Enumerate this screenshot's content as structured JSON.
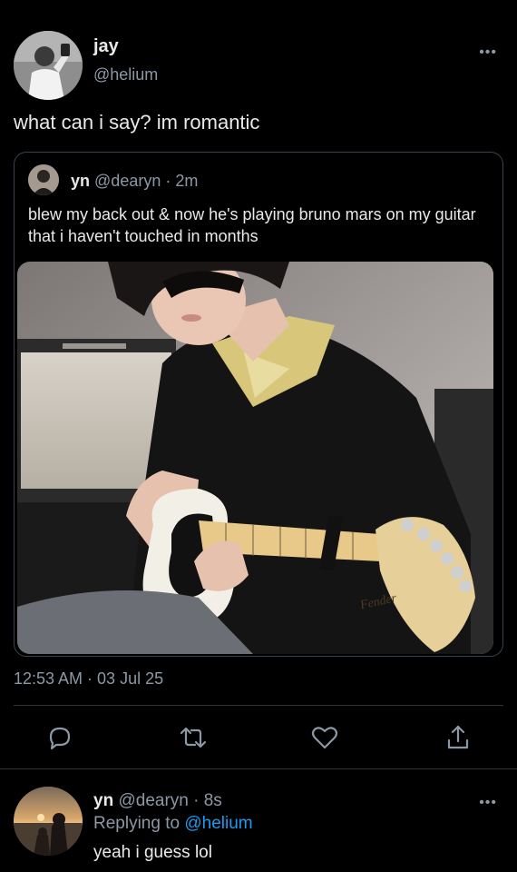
{
  "tweet": {
    "display_name": "jay",
    "handle": "@helium",
    "more_glyph": "•••",
    "text": "what can i say? im romantic",
    "timestamp": "12:53 AM · 03 Jul 25"
  },
  "quoted": {
    "display_name": "yn",
    "handle_time": "@dearyn · 2m",
    "text": "blew my back out & now he's playing bruno mars on my guitar that i haven't touched in months",
    "image_brand_text": "Fender"
  },
  "actions": {
    "reply_icon": "comment-bubble",
    "retweet_icon": "retweet-arrows",
    "like_icon": "heart-outline",
    "share_icon": "share-upload"
  },
  "reply": {
    "display_name": "yn",
    "handle_time": "@dearyn · 8s",
    "replying_prefix": "Replying to",
    "replying_to": "@helium",
    "text": "yeah i guess lol",
    "more_glyph": "•••"
  },
  "colors": {
    "background": "#000000",
    "text": "#e7e9ea",
    "secondary": "#8b98a5",
    "link": "#1d9bf0",
    "border": "#38444d"
  }
}
